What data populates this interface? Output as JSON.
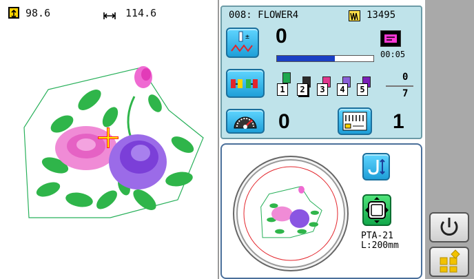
{
  "dimensions": {
    "height_value": "98.6",
    "width_value": "114.6",
    "height_icon": "vertical-size-icon",
    "width_icon": "horizontal-size-icon"
  },
  "info": {
    "design_name": "008: FLOWER4",
    "stitch_count_icon": "stitch-count-icon",
    "stitch_count": "13495",
    "stitch_position": "0",
    "progress_fraction": 0.6,
    "time": "00:05",
    "color_current": "0",
    "color_total": "7",
    "needles": [
      {
        "number": "1",
        "color": "#1fa84f"
      },
      {
        "number": "2",
        "color": "#2b2b2b"
      },
      {
        "number": "3",
        "color": "#e0388e"
      },
      {
        "number": "4",
        "color": "#8a60d8"
      },
      {
        "number": "5",
        "color": "#7a1fb8"
      }
    ],
    "speed_value": "0",
    "frame_count": "1"
  },
  "preview": {
    "frame_type": "PTA-21",
    "frame_size": "L:200mm"
  },
  "colors": {
    "panel_bg": "#bfe3ea",
    "accent_blue": "#1f9fd8",
    "accent_green": "#11a84a",
    "progress_blue": "#1a3fc4"
  }
}
